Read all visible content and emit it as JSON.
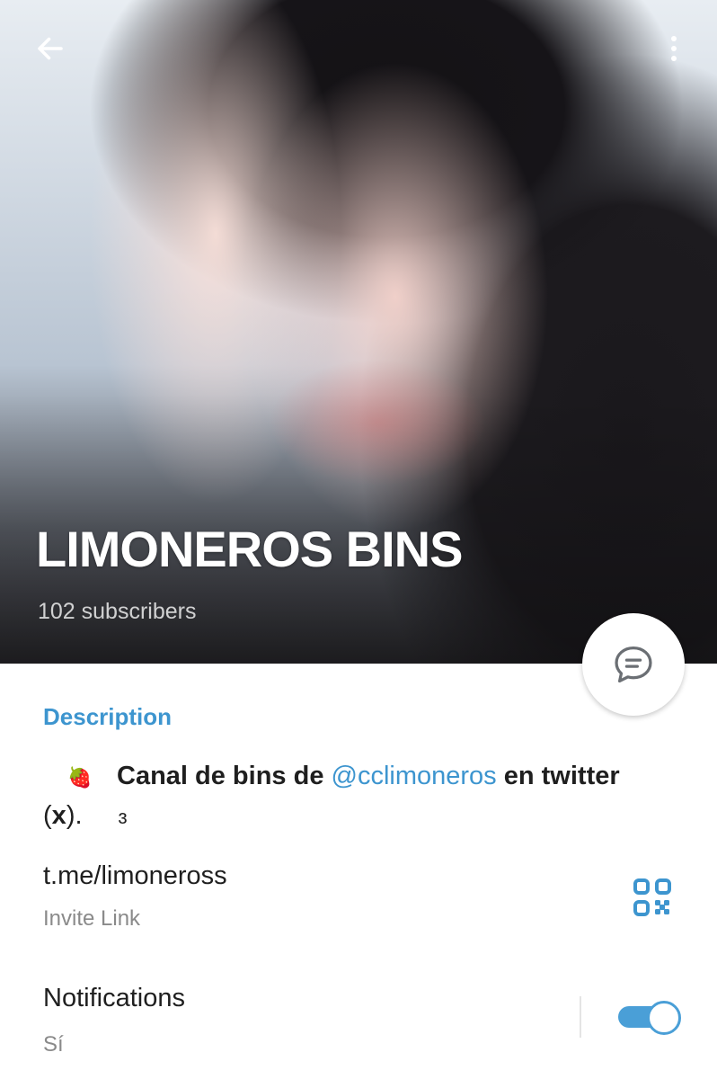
{
  "header": {
    "channel_name": "LIMONEROS BINS",
    "subscribers": "102 subscribers",
    "back_icon": "arrow-left-icon",
    "menu_icon": "more-vertical-icon"
  },
  "fab": {
    "icon": "chat-bubble-icon"
  },
  "description": {
    "title": "Description",
    "emoji_lead": "🍓",
    "text_part1": "Canal de bins de",
    "mention": "@cclimoneros",
    "text_part2": "en twitter",
    "paren_open": " (",
    "x_text": "x",
    "paren_close": ").",
    "tail_glyph": "ɜ"
  },
  "invite": {
    "link": "t.me/limoneross",
    "label": "Invite Link",
    "icon": "qr-code-icon"
  },
  "notifications": {
    "title": "Notifications",
    "value": "Sí",
    "toggle_on": true
  },
  "colors": {
    "accent": "#3d95cf",
    "toggle": "#4a9fd7"
  }
}
